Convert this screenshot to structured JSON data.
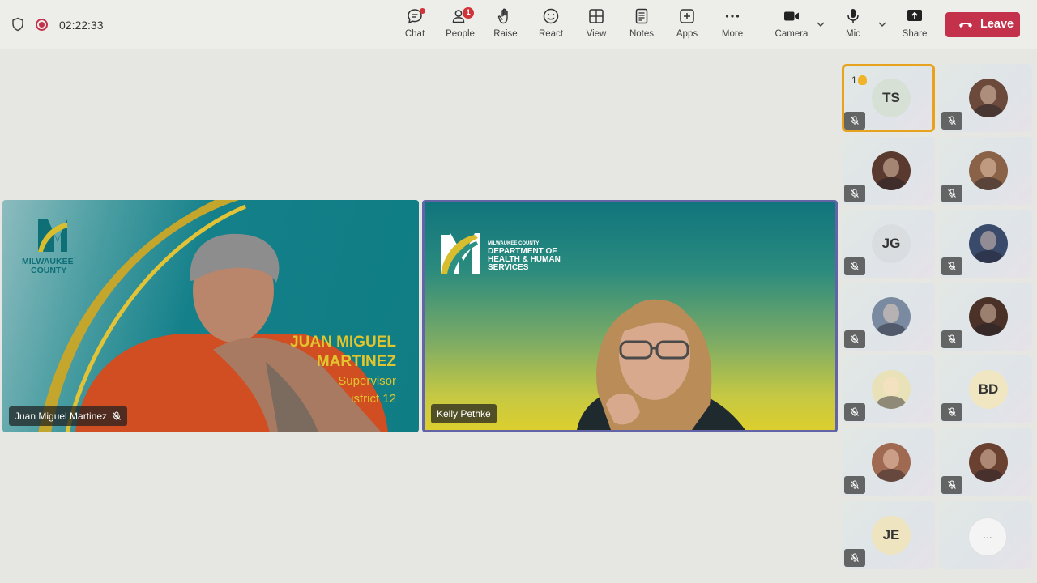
{
  "status": {
    "timer": "02:22:33"
  },
  "toolbar": {
    "chat": "Chat",
    "people": "People",
    "people_badge": "1",
    "raise": "Raise",
    "react": "React",
    "view": "View",
    "notes": "Notes",
    "apps": "Apps",
    "more": "More",
    "camera": "Camera",
    "mic": "Mic",
    "share": "Share",
    "leave": "Leave"
  },
  "videos": [
    {
      "name": "Juan Miguel Martinez",
      "background": {
        "logo_line1": "MILWAUKEE",
        "logo_line2": "COUNTY",
        "title_line1": "JUAN MIGUEL",
        "title_line2": "MARTINEZ",
        "role": "Supervisor",
        "district": "istrict 12"
      }
    },
    {
      "name": "Kelly Pethke",
      "background": {
        "org_small": "MILWAUKEE COUNTY",
        "org_line1": "DEPARTMENT OF",
        "org_line2": "HEALTH & HUMAN",
        "org_line3": "SERVICES"
      }
    }
  ],
  "gallery": [
    {
      "initials": "TS",
      "raised_count": "1",
      "avatar_color": "#d7e0d5"
    },
    {
      "initials": "",
      "avatar_color": "#6b4a3c"
    },
    {
      "initials": "",
      "avatar_color": "#5a3a2e"
    },
    {
      "initials": "",
      "avatar_color": "#8a6248"
    },
    {
      "initials": "JG",
      "avatar_color": "#d9dde0"
    },
    {
      "initials": "",
      "avatar_color": "#3a4a6a"
    },
    {
      "initials": "",
      "avatar_color": "#7a8aa0"
    },
    {
      "initials": "",
      "avatar_color": "#4a3228"
    },
    {
      "initials": "",
      "avatar_color": "#e9e2b8"
    },
    {
      "initials": "BD",
      "avatar_color": "#f1e6c2"
    },
    {
      "initials": "",
      "avatar_color": "#a06a52"
    },
    {
      "initials": "",
      "avatar_color": "#6a4030"
    },
    {
      "initials": "JE",
      "avatar_color": "#efe4c0"
    },
    {
      "more_label": "..."
    }
  ]
}
